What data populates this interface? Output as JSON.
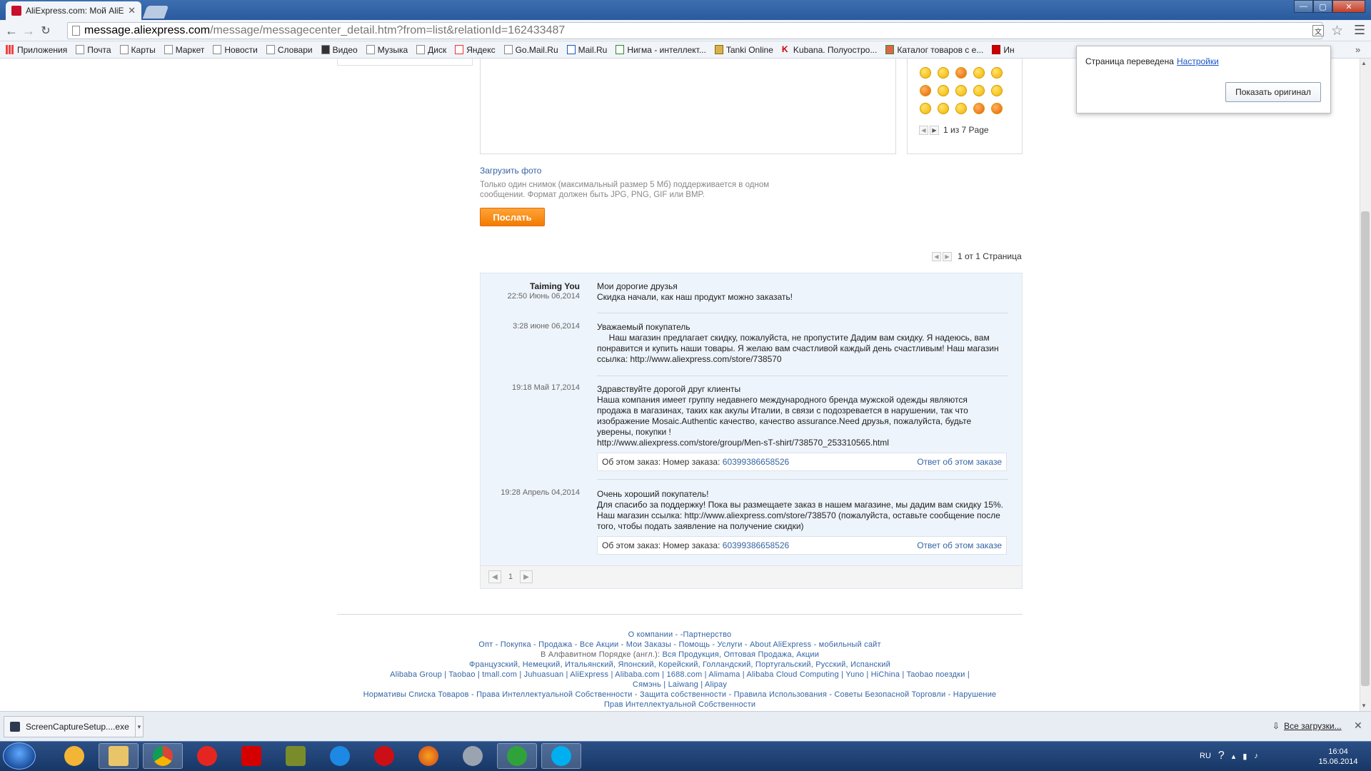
{
  "browser": {
    "tab_title": "AliExpress.com: Мой AliEx",
    "url_host": "message.aliexpress.com",
    "url_path": "/message/messagecenter_detail.htm?from=list&relationId=162433487",
    "bookmarks": [
      "Приложения",
      "Почта",
      "Карты",
      "Маркет",
      "Новости",
      "Словари",
      "Видео",
      "Музыка",
      "Диск",
      "Яндекс",
      "Go.Mail.Ru",
      "Mail.Ru",
      "Нигма - интеллект...",
      "Tanki Online",
      "Kubana. Полуостро...",
      "Каталог товаров с е...",
      "Ин"
    ]
  },
  "translate_popup": {
    "text": "Страница переведена",
    "settings_link": "Настройки",
    "show_original_button": "Показать оригинал"
  },
  "compose": {
    "emoji_pager": "1 из 7 Page",
    "upload_link": "Загрузить фото",
    "upload_hint": "Только один снимок (максимальный размер 5 Мб) поддерживается в одном сообщении. Формат должен быть JPG, PNG, GIF или BMP.",
    "send_button": "Послать"
  },
  "top_pager": "1 от 1 Страница",
  "messages": [
    {
      "author": "Taiming You",
      "time": "22:50 Июнь 06,2014",
      "lines": [
        "Мои дорогие друзья",
        "Скидка начали, как наш продукт можно заказать!"
      ]
    },
    {
      "time": "3:28 июне 06,2014",
      "lines": [
        "Уважаемый покупатель",
        "     Наш магазин предлагает скидку, пожалуйста, не пропустите Дадим вам скидку. Я надеюсь, вам понравится и купить наши товары. Я желаю вам счастливой каждый день счастливым! Наш магазин ссылка: http://www.aliexpress.com/store/738570"
      ]
    },
    {
      "time": "19:18 Май 17,2014",
      "lines": [
        "Здравствуйте дорогой друг клиенты",
        "Наша компания имеет группу недавнего международного бренда мужской одежды являются продажа в магазинах, таких как акулы Италии, в связи с подозревается в нарушении, так что изображение Mosaic.Authentic качество, качество assurance.Need друзья, пожалуйста, будьте уверены, покупки !",
        "http://www.aliexpress.com/store/group/Men-sT-shirt/738570_253310565.html"
      ],
      "order_label": "Об этом заказ: Номер заказа:",
      "order_number": "60399386658526",
      "order_reply": "Ответ об этом заказе"
    },
    {
      "time": "19:28 Апрель 04,2014",
      "lines": [
        "Очень хороший покупатель!",
        "Для спасибо за поддержку! Пока вы размещаете заказ в нашем магазине, мы дадим вам скидку 15%. Наш магазин ссылка: http://www.aliexpress.com/store/738570 (пожалуйста, оставьте сообщение после того, чтобы подать заявление на получение скидки)"
      ],
      "order_label": "Об этом заказ: Номер заказа:",
      "order_number": "60399386658526",
      "order_reply": "Ответ об этом заказе"
    }
  ],
  "bottom_pager_current": "1",
  "footer": {
    "line1": "О компании - -Партнерство",
    "line2": "Опт - Покупка - Продажа - Все Акции - Мои Заказы - Помощь - Услуги - About AliExpress - мобильный сайт",
    "line3_gray": "В Алфавитном Порядке (англ.):",
    "line3_links": "Вся Продукция, Оптовая Продажа, Акции",
    "line4": "Французский, Немецкий, Итальянский, Японский, Корейский, Голландский, Португальский, Русский, Испанский",
    "line5": "Alibaba Group | Taobao | tmall.com | Juhuasuan | AliExpress | Alibaba.com | 1688.com | Alimama | Alibaba Cloud Computing | Yuno | HiChina | Taobao поездки |",
    "line6": "Сямэнь | Laiwang | Alipay",
    "line7": "Нормативы Списка Товаров - Права Интеллектуальной Собственности - Защита собственности - Правила Использования - Советы Безопасной Торговли - Нарушение",
    "line8": "Прав Интеллектуальной Собственности"
  },
  "downloads": {
    "file": "ScreenCaptureSetup....exe",
    "all_link": "Все загрузки..."
  },
  "taskbar": {
    "lang": "RU",
    "time": "16:04",
    "date": "15.06.2014"
  },
  "colors": {
    "link": "#3465a4",
    "send_button": "#f27b00",
    "message_panel": "#eef4fb"
  }
}
